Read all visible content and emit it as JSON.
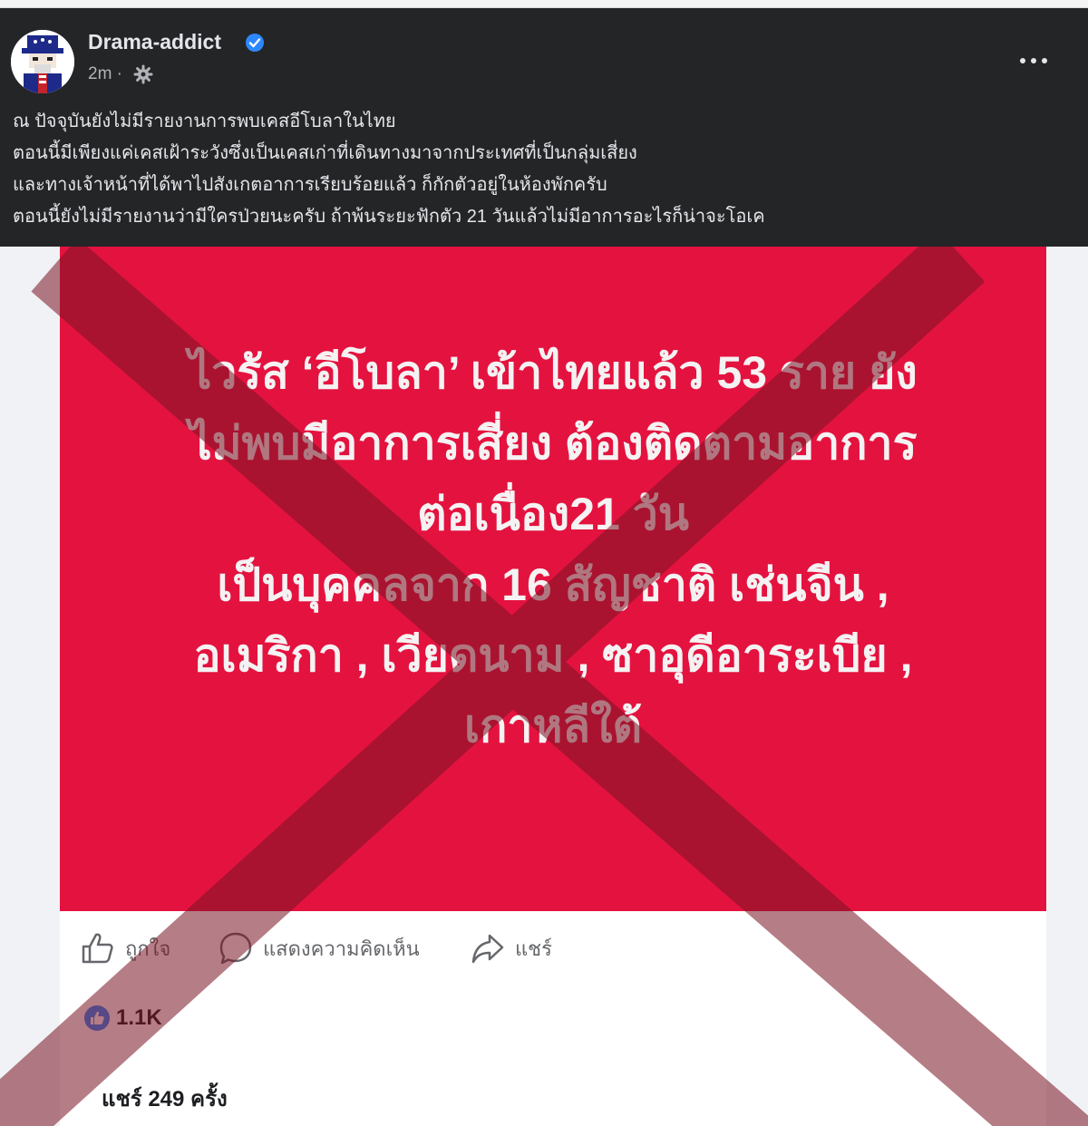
{
  "post": {
    "author": "Drama-addict",
    "time": "2m ·",
    "text_lines": [
      "ณ ปัจจุบันยังไม่มีรายงานการพบเคสอีโบลาในไทย",
      "ตอนนี้มีเพียงแค่เคสเฝ้าระวังซึ่งเป็นเคสเก่าที่เดินทางมาจากประเทศที่เป็นกลุ่มเสี่ยง",
      "และทางเจ้าหน้าที่ได้พาไปสังเกตอาการเรียบร้อยแล้ว ก็กักตัวอยู่ในห้องพักครับ",
      "ตอนนี้ยังไม่มีรายงานว่ามีใครป่วยนะครับ ถ้าพ้นระยะฟักตัว 21 วันแล้วไม่มีอาการอะไรก็น่าจะโอเค"
    ]
  },
  "shared": {
    "headline_lines": [
      "ไวรัส ‘อีโบลา’ เข้าไทยแล้ว 53 ราย ยัง",
      "ไม่พบมีอาการเสี่ยง ต้องติดตามอาการ",
      "ต่อเนื่อง21 วัน",
      "เป็นบุคคลจาก 16 สัญชาติ เช่นจีน ,",
      "อเมริกา , เวียดนาม , ซาอุดีอาระเบีย ,",
      "เกาหลีใต้"
    ],
    "actions": {
      "like": "ถูกใจ",
      "comment": "แสดงความคิดเห็น",
      "share": "แชร์"
    },
    "reaction_count": "1.1K",
    "share_count": "แชร์ 249 ครั้ง"
  },
  "icons": [
    "verified-icon",
    "gear-icon",
    "more-icon",
    "like-icon",
    "comment-icon",
    "share-icon"
  ],
  "colors": {
    "header_bg": "#242526",
    "banner_red": "#e4123f",
    "cross_overlay": "#8c1b2a",
    "verified_blue": "#2d88ff"
  }
}
